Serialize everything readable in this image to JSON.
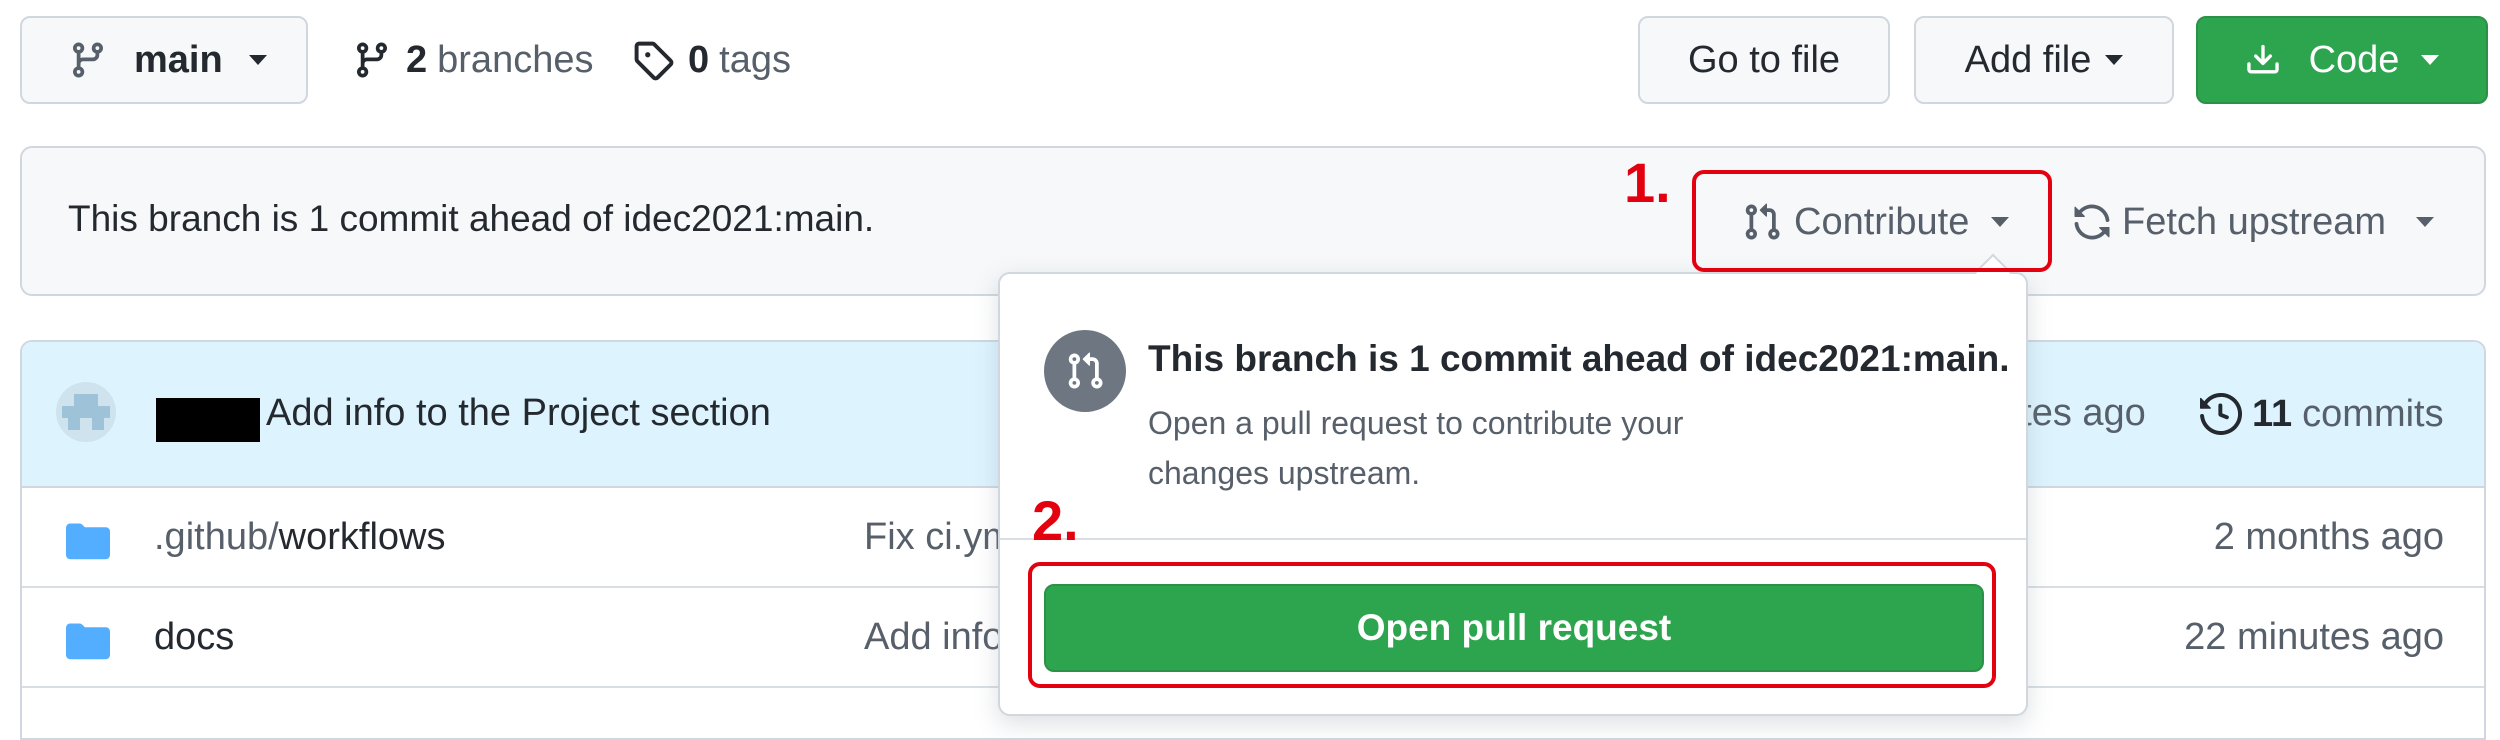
{
  "top": {
    "branch": "main",
    "branches_count": "2",
    "branches_label": "branches",
    "tags_count": "0",
    "tags_label": "tags",
    "go_to_file": "Go to file",
    "add_file": "Add file",
    "code": "Code"
  },
  "bar": {
    "status": "This branch is 1 commit ahead of idec2021:main.",
    "contribute": "Contribute",
    "fetch_upstream": "Fetch upstream"
  },
  "commit": {
    "message": "Add info to the Project section",
    "time_partial": "utes ago",
    "commits_count": "11",
    "commits_label": "commits"
  },
  "files": [
    {
      "name_prefix": ".github/",
      "name": "workflows",
      "message": "Fix ci.ym",
      "time": "2 months ago"
    },
    {
      "name_prefix": "",
      "name": "docs",
      "message": "Add info",
      "time": "22 minutes ago"
    }
  ],
  "popover": {
    "title": "This branch is 1 commit ahead of idec2021:main.",
    "description": "Open a pull request to contribute your changes upstream.",
    "open_pr": "Open pull request"
  },
  "annotations": {
    "step1": "1.",
    "step2": "2."
  },
  "colors": {
    "accent_green": "#2da44e",
    "annotation_red": "#e3000f",
    "folder_blue": "#54aeff"
  }
}
